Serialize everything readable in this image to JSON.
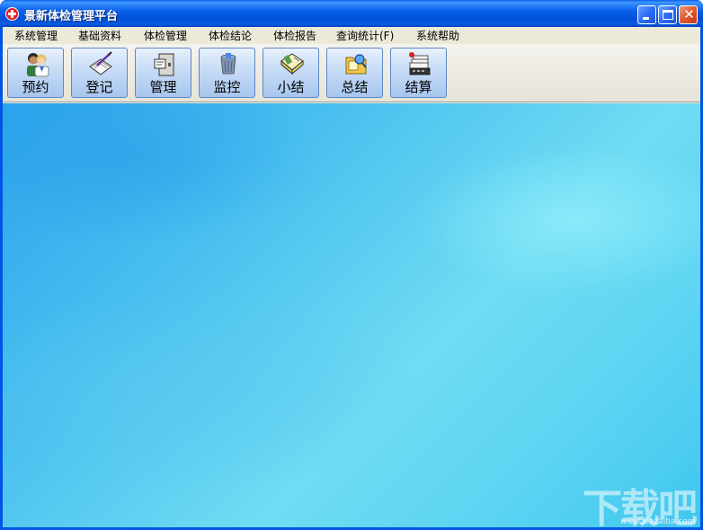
{
  "window": {
    "title": "景新体检管理平台",
    "icon": "red-cross-icon"
  },
  "menubar": {
    "items": [
      {
        "label": "系统管理"
      },
      {
        "label": "基础资料"
      },
      {
        "label": "体检管理"
      },
      {
        "label": "体检结论"
      },
      {
        "label": "体检报告"
      },
      {
        "label": "查询统计(F)"
      },
      {
        "label": "系统帮助"
      }
    ]
  },
  "toolbar": {
    "buttons": [
      {
        "label": "预约",
        "icon": "people-icon"
      },
      {
        "label": "登记",
        "icon": "register-pen-icon"
      },
      {
        "label": "管理",
        "icon": "manage-door-icon"
      },
      {
        "label": "监控",
        "icon": "monitor-bin-icon"
      },
      {
        "label": "小结",
        "icon": "summary-book-icon"
      },
      {
        "label": "总结",
        "icon": "folder-search-icon"
      },
      {
        "label": "结算",
        "icon": "cash-register-icon"
      }
    ]
  },
  "watermark": {
    "text": "下载吧",
    "url": "www.xiazaiba.com"
  },
  "colors": {
    "titlebar": "#0054e3",
    "client_bg": "#ece9d8",
    "desktop": "#4fc4f0"
  }
}
